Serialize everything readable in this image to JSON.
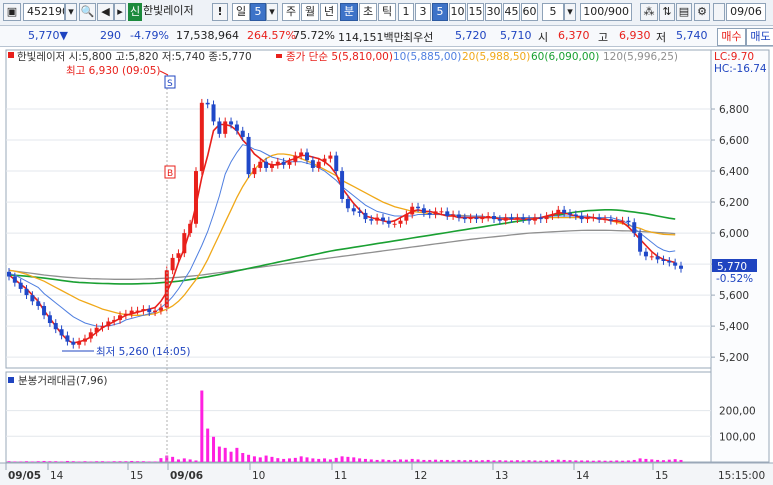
{
  "toolbar": {
    "code": "452190",
    "badge": "신",
    "stock_name": "한빛레이저",
    "warning": "!",
    "period_day": "일",
    "period_n": "5",
    "period_week": "주",
    "period_month": "월",
    "period_year": "년",
    "period_min": "분",
    "period_sec": "초",
    "period_tick": "틱",
    "intervals": [
      "1",
      "3",
      "5",
      "10",
      "15",
      "30",
      "45",
      "60"
    ],
    "interval_value": "5",
    "count": "100/900",
    "date": "09/06"
  },
  "price_row": {
    "price": "5,770▼",
    "change": "290",
    "change_pct": "-4.79%",
    "volume": "17,538,964",
    "volume_ratio": "264.57%",
    "turnover_ratio": "75.72%",
    "amount": "114,151백만",
    "bid_label": "최우선",
    "bid1": "5,720",
    "bid2": "5,710",
    "open_label": "시",
    "open": "6,370",
    "high_label": "고",
    "high": "6,930",
    "low_label": "저",
    "low": "5,740",
    "buy": "매수",
    "sell": "매도"
  },
  "legend": {
    "ohlc": "한빛레이저 시:5,800 고:5,820 저:5,740 종:5,770",
    "ma_main": "종가 단순 5(5,810,00)",
    "ma10": "10(5,885,00)",
    "ma20": "20(5,988,50)",
    "ma60": "60(6,090,00)",
    "ma120": "120(5,996,25)",
    "lc": "LC:9.70",
    "hc": "HC:-16.74"
  },
  "colors": {
    "up": "#e8201b",
    "down": "#2048c8",
    "ma5": "#e8201b",
    "ma10": "#4f7fe0",
    "ma20": "#f0a818",
    "ma60": "#1aa032",
    "ma120": "#909090",
    "volume": "#ff20e0"
  },
  "annotations": {
    "max": "최고 6,930 (09:05)",
    "min": "최저 5,260 (14:05)",
    "last_price": "5,770",
    "last_pct": "-0.52%",
    "sell_mark": "S",
    "buy_mark": "B"
  },
  "volume_panel": {
    "title": "분봉거래대금(7,96)"
  },
  "chart_data": {
    "type": "candlestick",
    "y_ticks": [
      "6,800",
      "6,600",
      "6,400",
      "6,200",
      "6,000",
      "5,800",
      "5,600",
      "5,400",
      "5,200"
    ],
    "y_tick_values": [
      6800,
      6600,
      6400,
      6200,
      6000,
      5800,
      5600,
      5400,
      5200
    ],
    "ylim": [
      5130,
      7000
    ],
    "volume_ticks": [
      "200,00",
      "100,00"
    ],
    "volume_tick_values": [
      200,
      100
    ],
    "volume_ylim": [
      0,
      280
    ],
    "x_labels": [
      "09/05",
      "14",
      "15",
      "09/06",
      "10",
      "11",
      "12",
      "13",
      "14",
      "15"
    ],
    "time_label": "15:15:00",
    "closes": [
      5720,
      5680,
      5640,
      5600,
      5560,
      5530,
      5470,
      5420,
      5380,
      5340,
      5300,
      5280,
      5300,
      5320,
      5360,
      5390,
      5400,
      5430,
      5440,
      5470,
      5480,
      5500,
      5500,
      5510,
      5490,
      5500,
      5520,
      5760,
      5840,
      5870,
      6000,
      6060,
      6400,
      6840,
      6830,
      6720,
      6640,
      6720,
      6700,
      6660,
      6620,
      6380,
      6420,
      6460,
      6420,
      6440,
      6460,
      6440,
      6460,
      6500,
      6520,
      6470,
      6420,
      6460,
      6480,
      6500,
      6400,
      6220,
      6160,
      6140,
      6130,
      6090,
      6080,
      6100,
      6080,
      6060,
      6060,
      6080,
      6120,
      6170,
      6160,
      6130,
      6120,
      6140,
      6140,
      6110,
      6120,
      6100,
      6090,
      6100,
      6090,
      6100,
      6110,
      6090,
      6080,
      6100,
      6090,
      6100,
      6090,
      6080,
      6100,
      6090,
      6110,
      6120,
      6150,
      6130,
      6120,
      6110,
      6090,
      6100,
      6100,
      6090,
      6090,
      6080,
      6080,
      6080,
      6070,
      6000,
      5880,
      5850,
      5850,
      5830,
      5820,
      5810,
      5790,
      5770
    ],
    "ma5": [
      5730,
      5700,
      5670,
      5640,
      5600,
      5560,
      5500,
      5450,
      5400,
      5350,
      5310,
      5290,
      5300,
      5310,
      5330,
      5360,
      5390,
      5410,
      5430,
      5450,
      5470,
      5480,
      5490,
      5500,
      5510,
      5520,
      5560,
      5620,
      5700,
      5810,
      5900,
      6020,
      6180,
      6360,
      6500,
      6660,
      6700,
      6700,
      6690,
      6660,
      6600,
      6560,
      6510,
      6480,
      6450,
      6440,
      6440,
      6450,
      6470,
      6480,
      6500,
      6500,
      6490,
      6480,
      6460,
      6430,
      6380,
      6290,
      6240,
      6190,
      6150,
      6110,
      6100,
      6090,
      6080,
      6070,
      6080,
      6100,
      6120,
      6140,
      6150,
      6140,
      6140,
      6130,
      6120,
      6110,
      6110,
      6100,
      6100,
      6100,
      6100,
      6100,
      6100,
      6100,
      6090,
      6090,
      6090,
      6090,
      6090,
      6090,
      6090,
      6100,
      6110,
      6120,
      6130,
      6130,
      6120,
      6110,
      6100,
      6100,
      6100,
      6090,
      6090,
      6080,
      6080,
      6070,
      6040,
      6000,
      5960,
      5920,
      5880,
      5850,
      5830,
      5820,
      5810
    ],
    "ma10": [
      5740,
      5730,
      5710,
      5690,
      5670,
      5650,
      5610,
      5580,
      5550,
      5520,
      5490,
      5460,
      5440,
      5420,
      5410,
      5400,
      5400,
      5400,
      5410,
      5420,
      5440,
      5450,
      5460,
      5470,
      5480,
      5490,
      5520,
      5550,
      5590,
      5640,
      5700,
      5760,
      5840,
      5920,
      6010,
      6120,
      6240,
      6380,
      6460,
      6520,
      6570,
      6560,
      6540,
      6530,
      6510,
      6490,
      6480,
      6470,
      6460,
      6460,
      6460,
      6450,
      6440,
      6420,
      6400,
      6370,
      6340,
      6300,
      6270,
      6240,
      6210,
      6180,
      6160,
      6140,
      6130,
      6120,
      6110,
      6110,
      6110,
      6110,
      6120,
      6120,
      6120,
      6120,
      6120,
      6120,
      6120,
      6110,
      6110,
      6110,
      6110,
      6110,
      6100,
      6100,
      6100,
      6100,
      6100,
      6100,
      6100,
      6100,
      6100,
      6100,
      6100,
      6110,
      6110,
      6110,
      6110,
      6110,
      6110,
      6110,
      6100,
      6100,
      6100,
      6100,
      6090,
      6080,
      6060,
      6030,
      6000,
      5970,
      5940,
      5910,
      5890,
      5880,
      5885
    ],
    "ma20": [
      5760,
      5755,
      5745,
      5735,
      5720,
      5705,
      5690,
      5670,
      5650,
      5630,
      5610,
      5590,
      5570,
      5555,
      5540,
      5525,
      5510,
      5500,
      5490,
      5480,
      5475,
      5470,
      5470,
      5470,
      5475,
      5480,
      5495,
      5510,
      5530,
      5560,
      5600,
      5650,
      5700,
      5760,
      5830,
      5910,
      5990,
      6070,
      6150,
      6230,
      6300,
      6360,
      6410,
      6450,
      6480,
      6500,
      6510,
      6510,
      6505,
      6495,
      6480,
      6465,
      6450,
      6430,
      6410,
      6390,
      6370,
      6340,
      6320,
      6300,
      6280,
      6260,
      6240,
      6220,
      6200,
      6185,
      6170,
      6160,
      6150,
      6140,
      6135,
      6130,
      6125,
      6120,
      6120,
      6118,
      6116,
      6114,
      6112,
      6110,
      6108,
      6106,
      6104,
      6102,
      6100,
      6100,
      6100,
      6100,
      6100,
      6100,
      6100,
      6100,
      6100,
      6100,
      6100,
      6100,
      6100,
      6100,
      6100,
      6100,
      6100,
      6095,
      6090,
      6080,
      6070,
      6060,
      6050,
      6040,
      6030,
      6015,
      6005,
      5998,
      5992,
      5990,
      5988
    ],
    "ma60": [
      5730,
      5728,
      5725,
      5722,
      5718,
      5714,
      5710,
      5705,
      5700,
      5695,
      5690,
      5685,
      5682,
      5680,
      5678,
      5676,
      5675,
      5674,
      5673,
      5672,
      5672,
      5672,
      5673,
      5674,
      5675,
      5677,
      5680,
      5683,
      5686,
      5690,
      5695,
      5700,
      5706,
      5712,
      5718,
      5725,
      5732,
      5740,
      5748,
      5756,
      5764,
      5772,
      5780,
      5788,
      5796,
      5804,
      5812,
      5820,
      5828,
      5836,
      5844,
      5852,
      5860,
      5868,
      5876,
      5884,
      5890,
      5896,
      5902,
      5908,
      5914,
      5920,
      5926,
      5932,
      5938,
      5944,
      5950,
      5956,
      5962,
      5968,
      5974,
      5980,
      5986,
      5992,
      5998,
      6004,
      6010,
      6016,
      6022,
      6028,
      6034,
      6040,
      6046,
      6052,
      6058,
      6064,
      6070,
      6076,
      6082,
      6088,
      6094,
      6100,
      6106,
      6112,
      6118,
      6124,
      6130,
      6136,
      6140,
      6144,
      6146,
      6148,
      6150,
      6150,
      6148,
      6145,
      6140,
      6135,
      6130,
      6125,
      6118,
      6110,
      6103,
      6096,
      6090
    ],
    "ma120": [
      5760,
      5755,
      5750,
      5745,
      5740,
      5735,
      5730,
      5726,
      5722,
      5718,
      5715,
      5712,
      5710,
      5708,
      5706,
      5705,
      5704,
      5703,
      5702,
      5702,
      5702,
      5702,
      5703,
      5704,
      5705,
      5706,
      5708,
      5710,
      5712,
      5715,
      5718,
      5722,
      5726,
      5730,
      5735,
      5740,
      5745,
      5750,
      5755,
      5760,
      5765,
      5770,
      5775,
      5780,
      5785,
      5790,
      5795,
      5800,
      5805,
      5810,
      5815,
      5820,
      5825,
      5830,
      5835,
      5840,
      5845,
      5850,
      5855,
      5860,
      5865,
      5870,
      5875,
      5880,
      5885,
      5890,
      5895,
      5900,
      5905,
      5910,
      5915,
      5920,
      5925,
      5930,
      5935,
      5940,
      5945,
      5950,
      5955,
      5960,
      5964,
      5968,
      5972,
      5976,
      5980,
      5984,
      5988,
      5992,
      5996,
      6000,
      6002,
      6004,
      6006,
      6008,
      6010,
      6012,
      6014,
      6016,
      6017,
      6018,
      6018,
      6018,
      6018,
      6017,
      6016,
      6015,
      6014,
      6012,
      6010,
      6008,
      6006,
      6004,
      6002,
      6000,
      5996
    ],
    "volumes": [
      3,
      2,
      2,
      3,
      2,
      3,
      4,
      3,
      3,
      2,
      4,
      3,
      2,
      3,
      2,
      3,
      3,
      2,
      3,
      3,
      3,
      4,
      3,
      3,
      2,
      2,
      15,
      25,
      20,
      10,
      14,
      10,
      6,
      278,
      130,
      98,
      60,
      55,
      40,
      55,
      35,
      28,
      22,
      18,
      25,
      20,
      15,
      12,
      14,
      16,
      22,
      18,
      14,
      12,
      14,
      10,
      16,
      22,
      20,
      18,
      14,
      12,
      10,
      8,
      10,
      8,
      8,
      10,
      9,
      12,
      10,
      8,
      8,
      9,
      8,
      8,
      7,
      8,
      7,
      8,
      6,
      7,
      8,
      6,
      7,
      6,
      6,
      7,
      6,
      7,
      6,
      5,
      6,
      7,
      9,
      8,
      7,
      6,
      6,
      6,
      5,
      6,
      5,
      5,
      6,
      5,
      6,
      8,
      14,
      12,
      10,
      8,
      7,
      9,
      11,
      8
    ]
  }
}
